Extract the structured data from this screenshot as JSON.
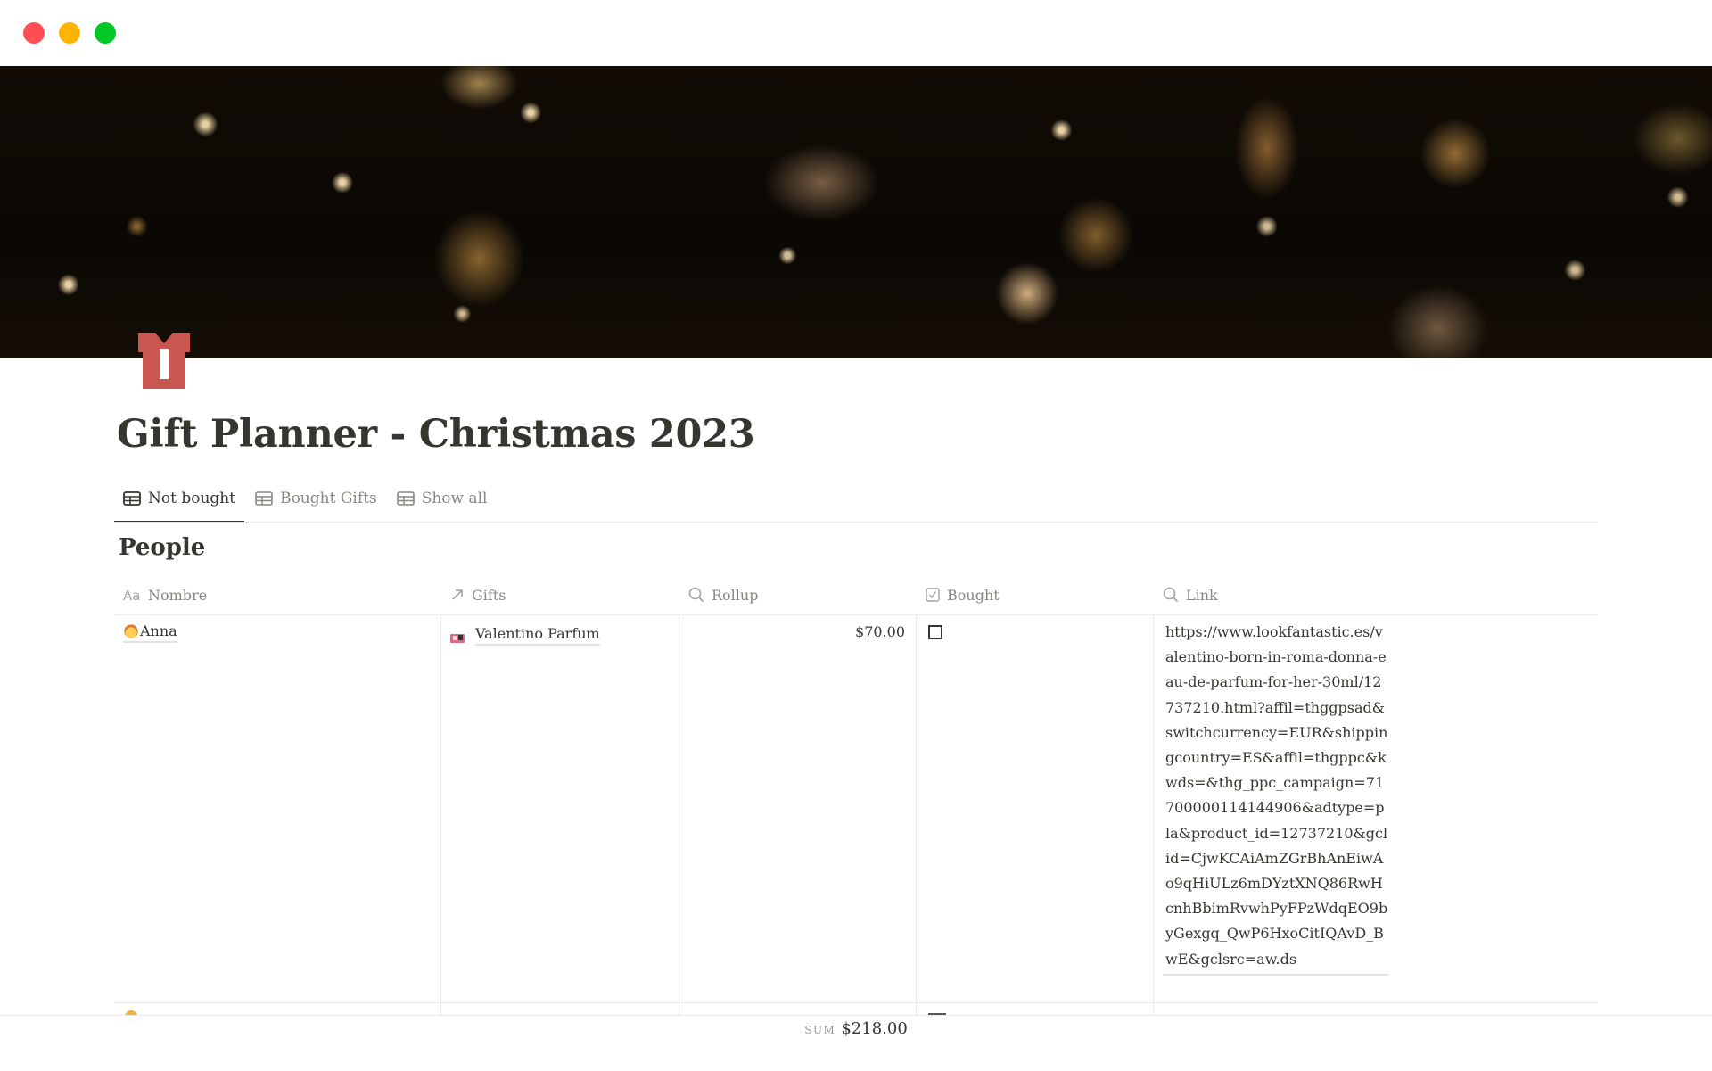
{
  "window": {
    "controls": [
      "close",
      "minimize",
      "maximize"
    ],
    "control_colors": {
      "close": "#ff4f55",
      "minimize": "#ffb400",
      "maximize": "#00c825"
    }
  },
  "cover": {
    "description": "Christmas tree ornaments with warm lights",
    "icon": "gift-icon",
    "icon_color": "#c9574f"
  },
  "page": {
    "title": "Gift Planner - Christmas 2023"
  },
  "tabs": [
    {
      "label": "Not bought",
      "icon": "table-icon",
      "active": true
    },
    {
      "label": "Bought Gifts",
      "icon": "table-icon",
      "active": false
    },
    {
      "label": "Show all",
      "icon": "table-icon",
      "active": false
    }
  ],
  "database": {
    "title": "People",
    "columns": [
      {
        "label": "Nombre",
        "icon": "title-aa-icon"
      },
      {
        "label": "Gifts",
        "icon": "relation-arrow-icon"
      },
      {
        "label": "Rollup",
        "icon": "search-icon"
      },
      {
        "label": "Bought",
        "icon": "checkbox-icon"
      },
      {
        "label": "Link",
        "icon": "search-icon"
      }
    ],
    "rows": [
      {
        "name": "Anna",
        "name_emoji": "woman-red-hair-emoji",
        "gift": "Valentino Parfum",
        "rollup": "$70.00",
        "bought": false,
        "link": "https://www.lookfantastic.es/valentino-born-in-roma-donna-eau-de-parfum-for-her-30ml/12737210.html?affil=thggpsad&switchcurrency=EUR&shippingcountry=ES&affil=thgppc&kwds=&thg_ppc_campaign=71700000114144906&adtype=pla&product_id=12737210&gclid=CjwKCAiAmZGrBhAnEiwAo9qHiULz6mDYztXNQ86RwHcnhBbimRvwhPyFPzWdqEO9byGexgq_QwP6HxoCitIQAvD_BwE&gclsrc=aw.ds"
      }
    ],
    "footer": {
      "aggregate_label": "SUM",
      "aggregate_value": "$218.00"
    }
  }
}
